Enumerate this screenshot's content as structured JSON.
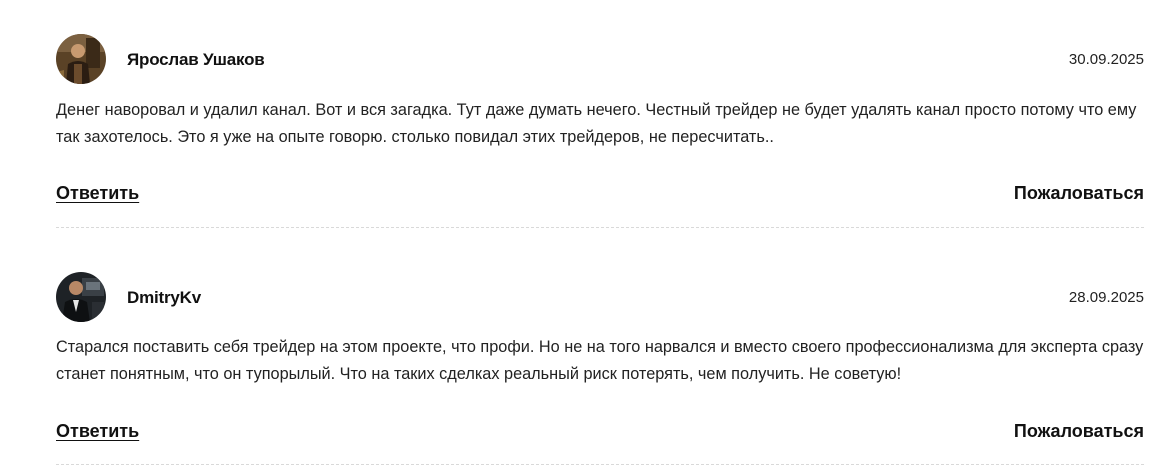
{
  "comments": [
    {
      "author": "Ярослав Ушаков",
      "date": "30.09.2025",
      "avatar_icon": "user-photo-avatar",
      "text": "Денег наворовал и удалил канал. Вот и вся загадка. Тут даже думать нечего. Честный трейдер не будет удалять канал просто потому что ему так захотелось. Это я уже на опыте говорю. столько повидал этих трейдеров, не пересчитать..",
      "reply_label": "Ответить",
      "report_label": "Пожаловаться"
    },
    {
      "author": "DmitryKv",
      "date": "28.09.2025",
      "avatar_icon": "user-photo-avatar",
      "text": "Старался поставить себя трейдер на этом проекте, что профи. Но не на того нарвался и вместо своего профессионализма для эксперта сразу станет понятным, что он тупорылый. Что на таких сделках реальный риск потерять, чем получить. Не советую!",
      "reply_label": "Ответить",
      "report_label": "Пожаловаться"
    }
  ]
}
